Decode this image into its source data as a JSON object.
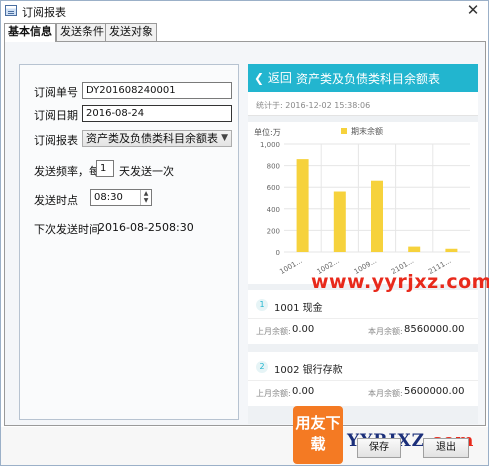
{
  "window": {
    "title": "订阅报表",
    "close_glyph": "✕"
  },
  "tabs": [
    {
      "label": "基本信息",
      "active": true
    },
    {
      "label": "发送条件",
      "active": false
    },
    {
      "label": "发送对象",
      "active": false
    }
  ],
  "form": {
    "order_no_label": "订阅单号",
    "order_no_value": "DY201608240001",
    "order_date_label": "订阅日期",
    "order_date_value": "2016-08-24",
    "report_label": "订阅报表",
    "report_value": "资产类及负债类科目余额表",
    "freq_label": "发送频率，每",
    "freq_value": "1",
    "freq_suffix": "天发送一次",
    "time_label": "发送时点",
    "time_value": "08:30",
    "next_label": "下次发送时间",
    "next_date": "2016-08-25",
    "next_time": "08:30"
  },
  "preview": {
    "back_label": "返回",
    "title": "资产类及负债类科目余额表",
    "stat_time": "统计于: 2016-12-02 15:38:06",
    "accounts": [
      {
        "num": "1",
        "name": "1001 现金",
        "prev_label": "上月余额:",
        "prev_value": "0.00",
        "cur_label": "本月余额:",
        "cur_value": "8560000.00"
      },
      {
        "num": "2",
        "name": "1002 银行存款",
        "prev_label": "上月余额:",
        "prev_value": "0.00",
        "cur_label": "本月余额:",
        "cur_value": "5600000.00"
      }
    ]
  },
  "chart_data": {
    "type": "bar",
    "unit_label": "单位:万",
    "legend": [
      "期末余额"
    ],
    "categories": [
      "1001...",
      "1002...",
      "1009...",
      "2101...",
      "2111..."
    ],
    "values": [
      860,
      560,
      660,
      50,
      30
    ],
    "ylim": [
      0,
      1000
    ],
    "yticks": [
      "1,000",
      "800",
      "600",
      "400",
      "200",
      "0"
    ],
    "grid": true,
    "color": "#f6d23c"
  },
  "watermark": {
    "text": "www.yyrjxz.com",
    "logo_text": "用友下载",
    "brand_main": "YYRJXZ",
    "brand_com": ".com"
  },
  "buttons": {
    "save": "保存",
    "exit": "退出"
  }
}
